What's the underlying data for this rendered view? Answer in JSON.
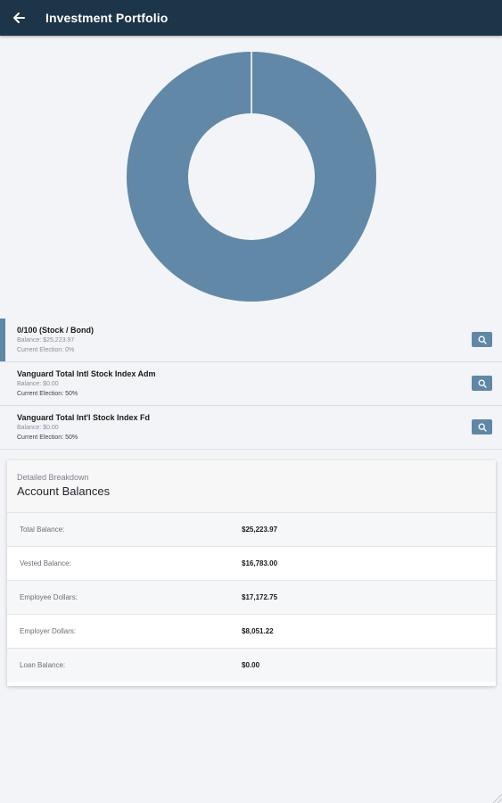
{
  "appbar": {
    "title": "Investment Portfolio",
    "back_icon": "arrow-left-icon",
    "background": "#1d3548"
  },
  "chart_data": {
    "type": "pie",
    "style": "donut",
    "slices": [
      {
        "label": "0/100 (Stock / Bond)",
        "value": 25223.97,
        "color": "#6189a7"
      },
      {
        "label": "Vanguard Total Intl Stock Index Adm",
        "value": 0.0,
        "color": "#6189a7"
      },
      {
        "label": "Vanguard Total Int'l Stock Index Fd",
        "value": 0.0,
        "color": "#6189a7"
      }
    ],
    "legend": "none"
  },
  "holdings": [
    {
      "name": "0/100 (Stock / Bond)",
      "balance": "Balance: $25,223.97",
      "election": "Current Election: 0%",
      "selected": true,
      "action_icon": "search-icon"
    },
    {
      "name": "Vanguard Total Intl Stock Index Adm",
      "balance": "Balance: $0.00",
      "election": "Current Election: 50%",
      "selected": false,
      "action_icon": "search-icon"
    },
    {
      "name": "Vanguard Total Int'l Stock Index Fd",
      "balance": "Balance: $0.00",
      "election": "Current Election: 50%",
      "selected": false,
      "action_icon": "search-icon"
    }
  ],
  "breakdown": {
    "eyebrow": "Detailed Breakdown",
    "title": "Account Balances",
    "rows": [
      {
        "label": "Total Balance:",
        "value": "$25,223.97"
      },
      {
        "label": "Vested Balance:",
        "value": "$16,783.00"
      },
      {
        "label": "Employee Dollars:",
        "value": "$17,172.75"
      },
      {
        "label": "Employer Dollars:",
        "value": "$8,051.22"
      },
      {
        "label": "Loan Balance:",
        "value": "$0.00"
      }
    ]
  },
  "colors": {
    "accent": "#5f88a6",
    "page_background": "#f3f4f7"
  }
}
